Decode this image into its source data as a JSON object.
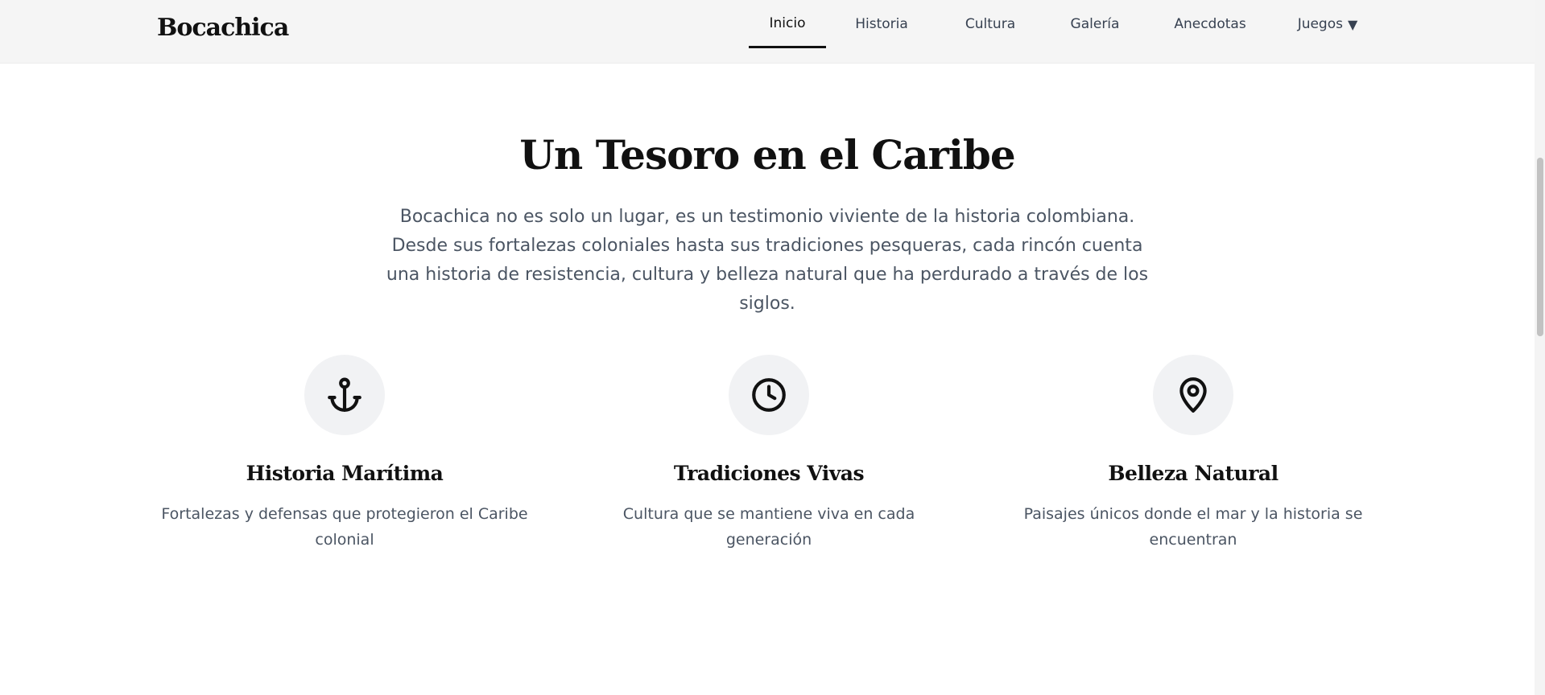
{
  "nav": {
    "brand": "Bocachica",
    "links": [
      {
        "label": "Inicio",
        "active": true
      },
      {
        "label": "Historia"
      },
      {
        "label": "Cultura"
      },
      {
        "label": "Galería"
      },
      {
        "label": "Anecdotas"
      },
      {
        "label": "Juegos",
        "dropdown_arrow": "▼"
      }
    ]
  },
  "hero": {
    "title": "Un Tesoro en el Caribe",
    "description": "Bocachica no es solo un lugar, es un testimonio viviente de la historia colombiana. Desde sus fortalezas coloniales hasta sus tradiciones pesqueras, cada rincón cuenta una historia de resistencia, cultura y belleza natural que ha perdurado a través de los siglos."
  },
  "features": [
    {
      "icon": "anchor-icon",
      "title": "Historia Marítima",
      "description": "Fortalezas y defensas que protegieron el Caribe colonial"
    },
    {
      "icon": "clock-icon",
      "title": "Tradiciones Vivas",
      "description": "Cultura que se mantiene viva en cada generación"
    },
    {
      "icon": "map-pin-icon",
      "title": "Belleza Natural",
      "description": "Paisajes únicos donde el mar y la historia se encuentran"
    }
  ],
  "colors": {
    "navbar_bg": "#f5f5f5",
    "heading": "#111111",
    "body_text": "#4b5563",
    "icon_circle": "#f1f2f4"
  }
}
